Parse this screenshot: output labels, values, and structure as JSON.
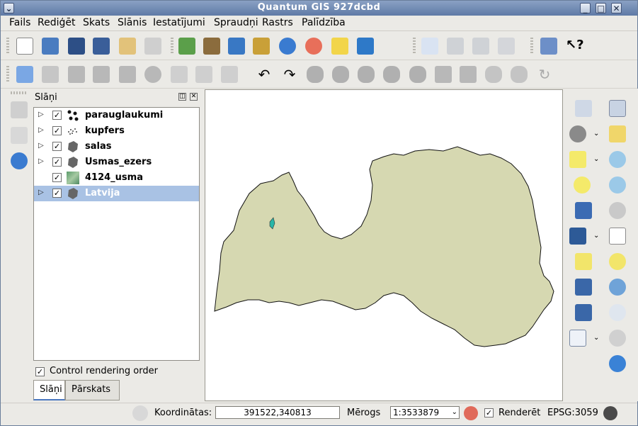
{
  "window": {
    "title": "Quantum GIS 927dcbd"
  },
  "menu": [
    "Fails",
    "Rediģēt",
    "Skats",
    "Slānis",
    "Iestatījumi",
    "Spraudņi",
    "Rastrs",
    "Palīdzība"
  ],
  "layers_panel": {
    "title": "Slāņi",
    "layers": [
      {
        "name": "parauglaukumi",
        "checked": true,
        "expandable": true,
        "icon": "point-layer-icon"
      },
      {
        "name": "kupfers",
        "checked": true,
        "expandable": true,
        "icon": "point-cloud-layer-icon"
      },
      {
        "name": "salas",
        "checked": true,
        "expandable": true,
        "icon": "polygon-layer-icon"
      },
      {
        "name": "Usmas_ezers",
        "checked": true,
        "expandable": true,
        "icon": "polygon-layer-icon"
      },
      {
        "name": "4124_usma",
        "checked": true,
        "expandable": false,
        "icon": "raster-layer-icon"
      },
      {
        "name": "Latvija",
        "checked": true,
        "expandable": true,
        "icon": "polygon-layer-icon",
        "selected": true
      }
    ],
    "control_rendering_order": "Control rendering order",
    "tabs": [
      "Slāņi",
      "Pārskats"
    ]
  },
  "status": {
    "coord_label": "Koordinātas:",
    "coord_value": "391522,340813",
    "scale_label": "Mērogs",
    "scale_value": "1:3533879",
    "render_label": "Renderēt",
    "crs": "EPSG:3059"
  },
  "colors": {
    "map_fill": "#d6d8b1",
    "selection": "#a9c2e4",
    "titlebar": "#6d86b0"
  }
}
